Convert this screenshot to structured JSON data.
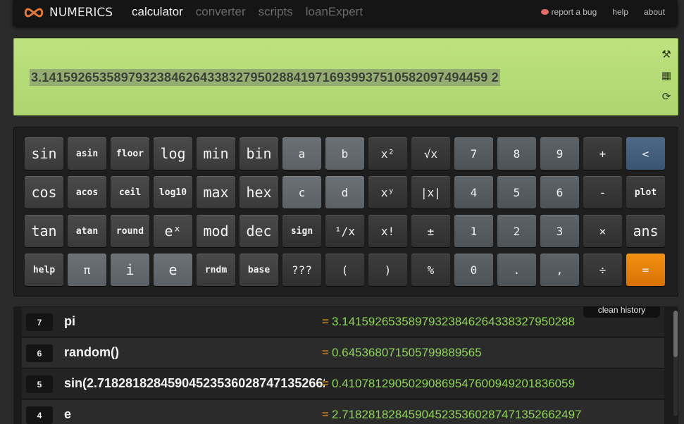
{
  "brand": {
    "name": "NUMERICS"
  },
  "nav": {
    "tabs": [
      "calculator",
      "converter",
      "scripts",
      "loanExpert"
    ],
    "active": 0
  },
  "links": {
    "report_bug": "report a bug",
    "help": "help",
    "about": "about"
  },
  "display": {
    "expression": "3.14159265358979323846264338327950288419716939937510582097494459 2",
    "icons": [
      "tools-icon",
      "keyboard-icon",
      "refresh-icon"
    ]
  },
  "keypad": {
    "rows": [
      [
        {
          "label": "sin",
          "type": "func",
          "size": "l"
        },
        {
          "label": "asin",
          "type": "func",
          "size": "s"
        },
        {
          "label": "floor",
          "type": "func",
          "size": "s"
        },
        {
          "label": "log",
          "type": "func",
          "size": "l"
        },
        {
          "label": "min",
          "type": "func",
          "size": "l"
        },
        {
          "label": "bin",
          "type": "func",
          "size": "l"
        },
        {
          "label": "a",
          "type": "var",
          "size": "m"
        },
        {
          "label": "b",
          "type": "var",
          "size": "m"
        },
        {
          "label": "x²",
          "type": "op",
          "size": "m"
        },
        {
          "label": "√x",
          "type": "op",
          "size": "m"
        },
        {
          "label": "7",
          "type": "num",
          "size": "m"
        },
        {
          "label": "8",
          "type": "num",
          "size": "m"
        },
        {
          "label": "9",
          "type": "num",
          "size": "m"
        },
        {
          "label": "+",
          "type": "op",
          "size": "m"
        },
        {
          "label": "<",
          "type": "back",
          "size": "m"
        }
      ],
      [
        {
          "label": "cos",
          "type": "func",
          "size": "l"
        },
        {
          "label": "acos",
          "type": "func",
          "size": "s"
        },
        {
          "label": "ceil",
          "type": "func",
          "size": "s"
        },
        {
          "label": "log10",
          "type": "func",
          "size": "s"
        },
        {
          "label": "max",
          "type": "func",
          "size": "l"
        },
        {
          "label": "hex",
          "type": "func",
          "size": "l"
        },
        {
          "label": "c",
          "type": "var",
          "size": "m"
        },
        {
          "label": "d",
          "type": "var",
          "size": "m"
        },
        {
          "label": "xʸ",
          "type": "op",
          "size": "m"
        },
        {
          "label": "|x|",
          "type": "op",
          "size": "m"
        },
        {
          "label": "4",
          "type": "num",
          "size": "m"
        },
        {
          "label": "5",
          "type": "num",
          "size": "m"
        },
        {
          "label": "6",
          "type": "num",
          "size": "m"
        },
        {
          "label": "-",
          "type": "op",
          "size": "m"
        },
        {
          "label": "plot",
          "type": "op",
          "size": "s"
        }
      ],
      [
        {
          "label": "tan",
          "type": "func",
          "size": "l"
        },
        {
          "label": "atan",
          "type": "func",
          "size": "s"
        },
        {
          "label": "round",
          "type": "func",
          "size": "s"
        },
        {
          "label": "eˣ",
          "type": "func",
          "size": "l"
        },
        {
          "label": "mod",
          "type": "func",
          "size": "l"
        },
        {
          "label": "dec",
          "type": "func",
          "size": "l"
        },
        {
          "label": "sign",
          "type": "op",
          "size": "s"
        },
        {
          "label": "¹/x",
          "type": "op",
          "size": "m"
        },
        {
          "label": "x!",
          "type": "op",
          "size": "m"
        },
        {
          "label": "±",
          "type": "op",
          "size": "m"
        },
        {
          "label": "1",
          "type": "num",
          "size": "m"
        },
        {
          "label": "2",
          "type": "num",
          "size": "m"
        },
        {
          "label": "3",
          "type": "num",
          "size": "m"
        },
        {
          "label": "×",
          "type": "op",
          "size": "m"
        },
        {
          "label": "ans",
          "type": "op",
          "size": "l"
        }
      ],
      [
        {
          "label": "help",
          "type": "func",
          "size": "s"
        },
        {
          "label": "π",
          "type": "var",
          "size": "m"
        },
        {
          "label": "i",
          "type": "var",
          "size": "l"
        },
        {
          "label": "e",
          "type": "var",
          "size": "l"
        },
        {
          "label": "rndm",
          "type": "func",
          "size": "s"
        },
        {
          "label": "base",
          "type": "func",
          "size": "s"
        },
        {
          "label": "???",
          "type": "op",
          "size": "m"
        },
        {
          "label": "(",
          "type": "op",
          "size": "m"
        },
        {
          "label": ")",
          "type": "op",
          "size": "m"
        },
        {
          "label": "%",
          "type": "op",
          "size": "m"
        },
        {
          "label": "0",
          "type": "num",
          "size": "m"
        },
        {
          "label": ".",
          "type": "num",
          "size": "m"
        },
        {
          "label": ",",
          "type": "num",
          "size": "m"
        },
        {
          "label": "÷",
          "type": "op",
          "size": "m"
        },
        {
          "label": "=",
          "type": "eq",
          "size": "m"
        }
      ]
    ]
  },
  "history": {
    "clean_label": "clean history",
    "entries": [
      {
        "n": "7",
        "expr": "pi",
        "result": "3.14159265358979323846264338327950288"
      },
      {
        "n": "6",
        "expr": "random()",
        "result": "0.645368071505799889565"
      },
      {
        "n": "5",
        "expr": "sin(2.718281828459045235360287471352662",
        "result": "0.41078129050290869547600949201836059"
      },
      {
        "n": "4",
        "expr": "e",
        "result": "2.718281828459045235360287471352662497"
      }
    ]
  }
}
